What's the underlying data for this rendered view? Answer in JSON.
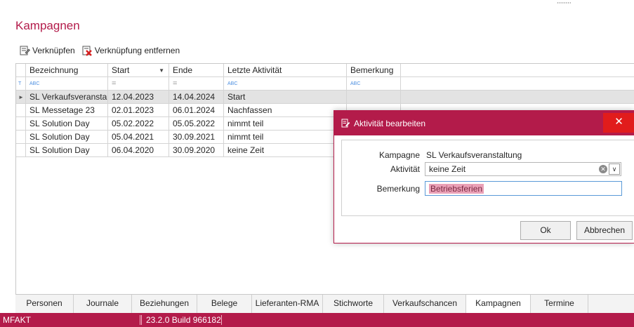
{
  "page": {
    "title": "Kampagnen"
  },
  "toolbar": {
    "link_label": "Verknüpfen",
    "unlink_label": "Verknüpfung entfernen"
  },
  "grid": {
    "columns": [
      "Bezeichnung",
      "Start",
      "Ende",
      "Letzte Aktivität",
      "Bemerkung"
    ],
    "sort_column": "Start",
    "filter_row": [
      "ABC",
      "=",
      "=",
      "ABC",
      "ABC"
    ],
    "rows": [
      {
        "bezeichnung": "SL Verkaufsveranstalt...",
        "start": "12.04.2023",
        "ende": "14.04.2024",
        "aktivitaet": "Start",
        "bemerkung": "",
        "selected": true
      },
      {
        "bezeichnung": "SL Messetage 23",
        "start": "02.01.2023",
        "ende": "06.01.2024",
        "aktivitaet": "Nachfassen",
        "bemerkung": ""
      },
      {
        "bezeichnung": "SL Solution Day",
        "start": "05.02.2022",
        "ende": "05.05.2022",
        "aktivitaet": "nimmt teil",
        "bemerkung": ""
      },
      {
        "bezeichnung": "SL Solution Day",
        "start": "05.04.2021",
        "ende": "30.09.2021",
        "aktivitaet": "nimmt teil",
        "bemerkung": ""
      },
      {
        "bezeichnung": "SL Solution Day",
        "start": "06.04.2020",
        "ende": "30.09.2020",
        "aktivitaet": "keine Zeit",
        "bemerkung": ""
      }
    ]
  },
  "tabs": [
    {
      "label": "Personen",
      "active": false
    },
    {
      "label": "Journale",
      "active": false
    },
    {
      "label": "Beziehungen",
      "active": false
    },
    {
      "label": "Belege",
      "active": false
    },
    {
      "label": "Lieferanten-RMA",
      "active": false
    },
    {
      "label": "Stichworte",
      "active": false
    },
    {
      "label": "Verkaufschancen",
      "active": false
    },
    {
      "label": "Kampagnen",
      "active": true
    },
    {
      "label": "Termine",
      "active": false
    }
  ],
  "status": {
    "app": "MFAKT",
    "build": "23.2.0 Build 966182"
  },
  "dialog": {
    "title": "Aktivität bearbeiten",
    "close_glyph": "✕",
    "kampagne_label": "Kampagne",
    "kampagne_value": "SL Verkaufsveranstaltung",
    "aktivitaet_label": "Aktivität",
    "aktivitaet_value": "keine Zeit",
    "bemerkung_label": "Bemerkung",
    "bemerkung_value": "Betriebsferien",
    "ok_label": "Ok",
    "cancel_label": "Abbrechen"
  },
  "colors": {
    "accent": "#b31b4a",
    "close": "#e11c1c",
    "selection": "#e3e3e3"
  },
  "icons": [
    "link-icon",
    "unlink-icon",
    "filter-icon",
    "sort-down-icon",
    "row-indicator-icon",
    "edit-icon",
    "clear-icon",
    "chevron-down-icon"
  ]
}
